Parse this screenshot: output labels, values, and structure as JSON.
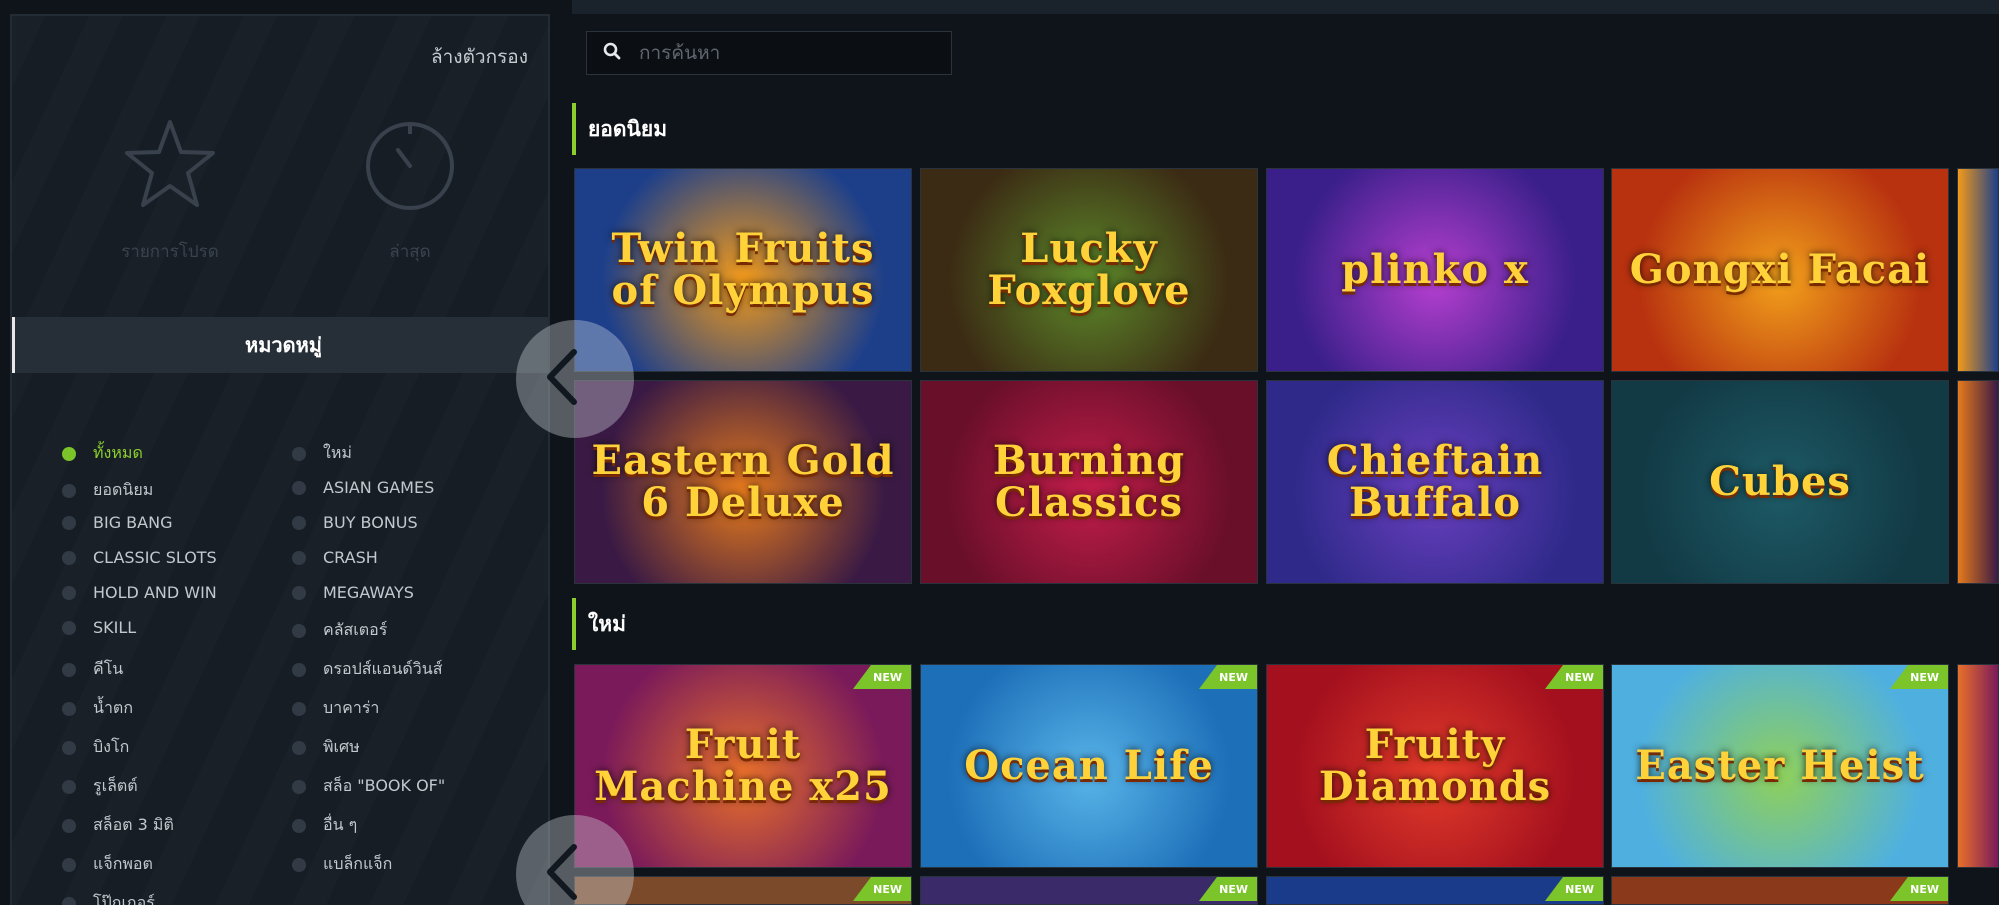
{
  "sidebar": {
    "clear_filter": "ล้างตัวกรอง",
    "favorites_label": "รายการโปรด",
    "recent_label": "ล่าสุด",
    "categories_header": "หมวดหมู่",
    "categories": [
      {
        "label": "ทั้งหมด",
        "active": true
      },
      {
        "label": "ใหม่"
      },
      {
        "label": "ยอดนิยม"
      },
      {
        "label": "ASIAN GAMES"
      },
      {
        "label": "BIG BANG"
      },
      {
        "label": "BUY BONUS"
      },
      {
        "label": "CLASSIC SLOTS"
      },
      {
        "label": "CRASH"
      },
      {
        "label": "HOLD AND WIN"
      },
      {
        "label": "MEGAWAYS"
      },
      {
        "label": "SKILL"
      },
      {
        "label": "คลัสเตอร์"
      },
      {
        "label": "คีโน"
      },
      {
        "label": "ดรอปส์แอนด์วินส์"
      },
      {
        "label": "น้ำตก"
      },
      {
        "label": "บาคาร่า"
      },
      {
        "label": "บิงโก"
      },
      {
        "label": "พิเศษ"
      },
      {
        "label": "รูเล็ตต์"
      },
      {
        "label": "สล็อ \"BOOK OF\""
      },
      {
        "label": "สล็อต 3 มิติ"
      },
      {
        "label": "อื่น ๆ"
      },
      {
        "label": "แจ็กพอต"
      },
      {
        "label": "แบล็กแจ็ก"
      },
      {
        "label": "โป๊กเกอร์"
      }
    ]
  },
  "search": {
    "placeholder": "การค้นหา"
  },
  "sections": {
    "popular": {
      "title": "ยอดนิยม",
      "games": [
        {
          "name": "Twin Fruits of Olympus",
          "bg": "#1d3f8a",
          "accent": "#f29a1a"
        },
        {
          "name": "Lucky Foxglove",
          "bg": "#3b2a14",
          "accent": "#5d8a2a"
        },
        {
          "name": "plinko x",
          "bg": "#3a1f8a",
          "accent": "#b63fd0"
        },
        {
          "name": "Gongxi Facai",
          "bg": "#b8320f",
          "accent": "#f2a01b"
        },
        {
          "name": "Eastern Gold 6 Deluxe",
          "bg": "#3a1a44",
          "accent": "#e57a1c"
        },
        {
          "name": "Burning Classics",
          "bg": "#6a0f2a",
          "accent": "#c21d4a"
        },
        {
          "name": "Chieftain Buffalo",
          "bg": "#2f2a8a",
          "accent": "#6a3fbf"
        },
        {
          "name": "Cubes",
          "bg": "#123a45",
          "accent": "#1d5a66"
        }
      ]
    },
    "new": {
      "title": "ใหม่",
      "badge": "NEW",
      "games": [
        {
          "name": "Fruit Machine x25",
          "bg": "#7a1a5a",
          "accent": "#e8702a"
        },
        {
          "name": "Ocean Life",
          "bg": "#1d6fb8",
          "accent": "#58b4e8"
        },
        {
          "name": "Fruity Diamonds",
          "bg": "#a4101e",
          "accent": "#e23b2a"
        },
        {
          "name": "Easter Heist",
          "bg": "#4fb0e0",
          "accent": "#8fd05a"
        }
      ]
    }
  }
}
